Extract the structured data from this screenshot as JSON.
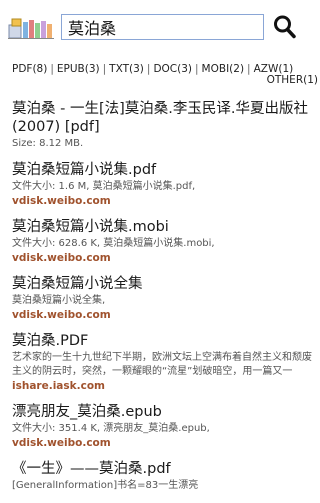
{
  "search": {
    "value": "莫泊桑"
  },
  "filters": [
    {
      "label": "PDF(8)"
    },
    {
      "label": "EPUB(3)"
    },
    {
      "label": "TXT(3)"
    },
    {
      "label": "DOC(3)"
    },
    {
      "label": "MOBI(2)"
    },
    {
      "label": "AZW(1)"
    }
  ],
  "other_filter": "OTHER(1)",
  "separator": "|",
  "results": [
    {
      "title": "莫泊桑 - 一生[法]莫泊桑.李玉民译.华夏出版社(2007) [pdf]",
      "desc": "Size: 8.12 MB.",
      "source": ""
    },
    {
      "title": "莫泊桑短篇小说集.pdf",
      "desc": "文件大小: 1.6 M, 莫泊桑短篇小说集.pdf,",
      "source": "vdisk.weibo.com"
    },
    {
      "title": "莫泊桑短篇小说集.mobi",
      "desc": "文件大小: 628.6 K, 莫泊桑短篇小说集.mobi,",
      "source": "vdisk.weibo.com"
    },
    {
      "title": "莫泊桑短篇小说全集",
      "desc": "莫泊桑短篇小说全集,",
      "source": "vdisk.weibo.com"
    },
    {
      "title": "莫泊桑.PDF",
      "desc": "艺术家的一生十九世纪下半期，欧洲文坛上空满布着自然主义和颓废主义的阴云时，突然，一颗耀眼的“流星”划破暗空，用一篇又一",
      "source": "ishare.iask.com"
    },
    {
      "title": "漂亮朋友_莫泊桑.epub",
      "desc": "文件大小: 351.4 K, 漂亮朋友_莫泊桑.epub,",
      "source": "vdisk.weibo.com"
    },
    {
      "title": "《一生》——莫泊桑.pdf",
      "desc": "[GeneralInformation]书名=83一生漂亮",
      "source": ""
    }
  ]
}
